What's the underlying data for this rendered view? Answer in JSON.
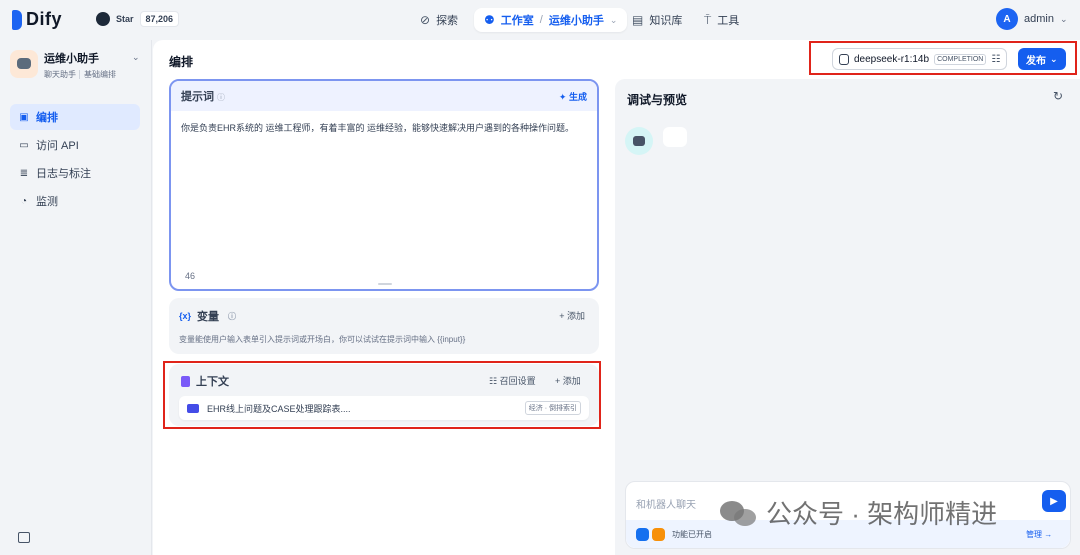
{
  "topbar": {
    "logo_text": "Dify",
    "github_star_label": "Star",
    "github_star_count": "87,206",
    "nav": {
      "explore": "探索",
      "studio": "工作室",
      "current_app": "运维小助手",
      "knowledge": "知识库",
      "tools": "工具"
    },
    "user": {
      "initial": "A",
      "name": "admin"
    }
  },
  "sidebar": {
    "app_name": "运维小助手",
    "app_tags": [
      "聊天助手",
      "基础编排"
    ],
    "items": [
      {
        "label": "编排",
        "icon": "layout-icon",
        "active": true
      },
      {
        "label": "访问 API",
        "icon": "terminal-icon",
        "active": false
      },
      {
        "label": "日志与标注",
        "icon": "file-list-icon",
        "active": false
      },
      {
        "label": "监测",
        "icon": "dashboard-icon",
        "active": false
      }
    ]
  },
  "main": {
    "title": "编排",
    "model": {
      "name": "deepseek-r1:14b",
      "mode": "COMPLETION"
    },
    "publish_label": "发布",
    "prompt": {
      "title": "提示词",
      "generate_label": "生成",
      "text": "你是负责EHR系统的 运维工程师，有着丰富的 运维经验，能够快速解决用户遇到的各种操作问题。",
      "char_count": "46"
    },
    "variables": {
      "title": "变量",
      "add_label": "添加",
      "description": "变量能使用户输入表单引入提示词或开场白，你可以试试在提示词中输入 {{input}}"
    },
    "context": {
      "title": "上下文",
      "recall_label": "召回设置",
      "add_label": "添加",
      "items": [
        {
          "name": "EHR线上问题及CASE处理跟踪表....",
          "badge": "经济 · 倒排索引"
        }
      ]
    }
  },
  "debug": {
    "title": "调试与预览",
    "input_placeholder": "和机器人聊天",
    "features_label": "功能已开启",
    "manage_label": "管理"
  },
  "watermark": "公众号 · 架构师精进",
  "colors": {
    "accent": "#155eef",
    "highlight_box": "#e0241a"
  }
}
